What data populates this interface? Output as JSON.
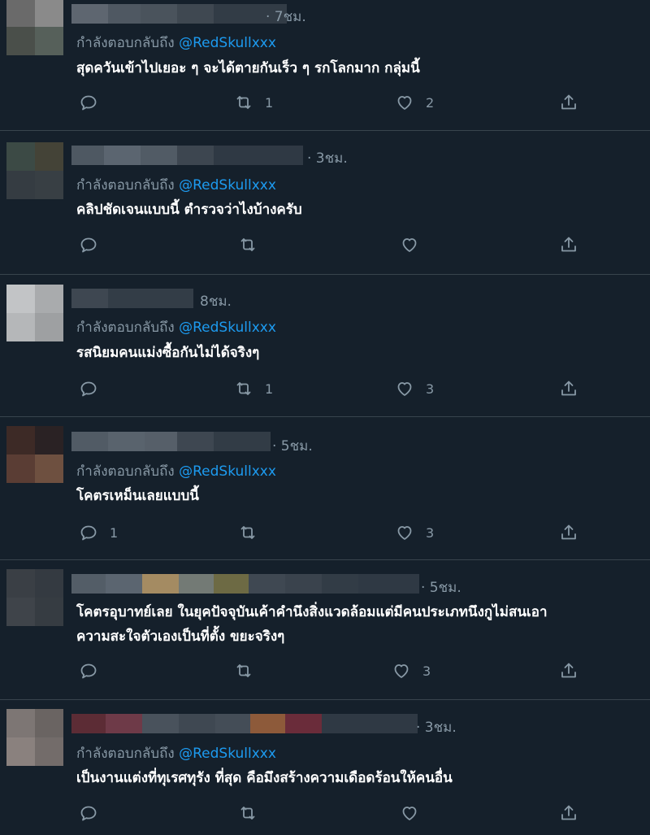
{
  "reply_prefix": "กำลังตอบกลับถึง",
  "handle": "@RedSkullxxx",
  "colors": {
    "background": "#15202b",
    "handle": "#1d9bf0",
    "muted": "#8899a6",
    "divider": "#38444d"
  },
  "icons": {
    "reply": "reply-icon",
    "retweet": "retweet-icon",
    "like": "like-icon",
    "share": "share-icon"
  },
  "tweets": [
    {
      "time": "· 7ชม.",
      "text": "สุดควันเข้าไปเยอะ ๆ จะได้ตายกันเร็ว ๆ รกโลกมาก กลุ่มนี้",
      "text2": "",
      "replies": "",
      "retweets": "1",
      "likes": "2"
    },
    {
      "time": "· 3ชม.",
      "text": "คลิปชัดเจนแบบนี้ ตำรวจว่าไงบ้างครับ",
      "text2": "",
      "replies": "",
      "retweets": "",
      "likes": ""
    },
    {
      "time": "8ชม.",
      "text": "รสนิยมคนแม่งซื้อกันไม่ได้จริงๆ",
      "text2": "",
      "replies": "",
      "retweets": "1",
      "likes": "3"
    },
    {
      "time": "· 5ชม.",
      "text": "โคตรเหม็นเลยแบบนี้",
      "text2": "",
      "replies": "1",
      "retweets": "",
      "likes": "3"
    },
    {
      "time": "· 5ชม.",
      "text": "โคตรอุบาทย์เลย ในยุคปัจจุบันเค้าคำนึงสิ่งแวดล้อมแต่มีคนประเภทนึงกูไม่สนเอา",
      "text2": "ความสะใจตัวเองเป็นที่ตั้ง ขยะจริงๆ",
      "replies": "",
      "retweets": "",
      "likes": "3"
    },
    {
      "time": "· 3ชม.",
      "text": "เป็นงานแต่งที่ทุเรศทุรัง ที่สุด คือมึงสร้างความเดือดร้อนให้คนอื่น",
      "text2": "",
      "replies": "",
      "retweets": "",
      "likes": ""
    }
  ]
}
